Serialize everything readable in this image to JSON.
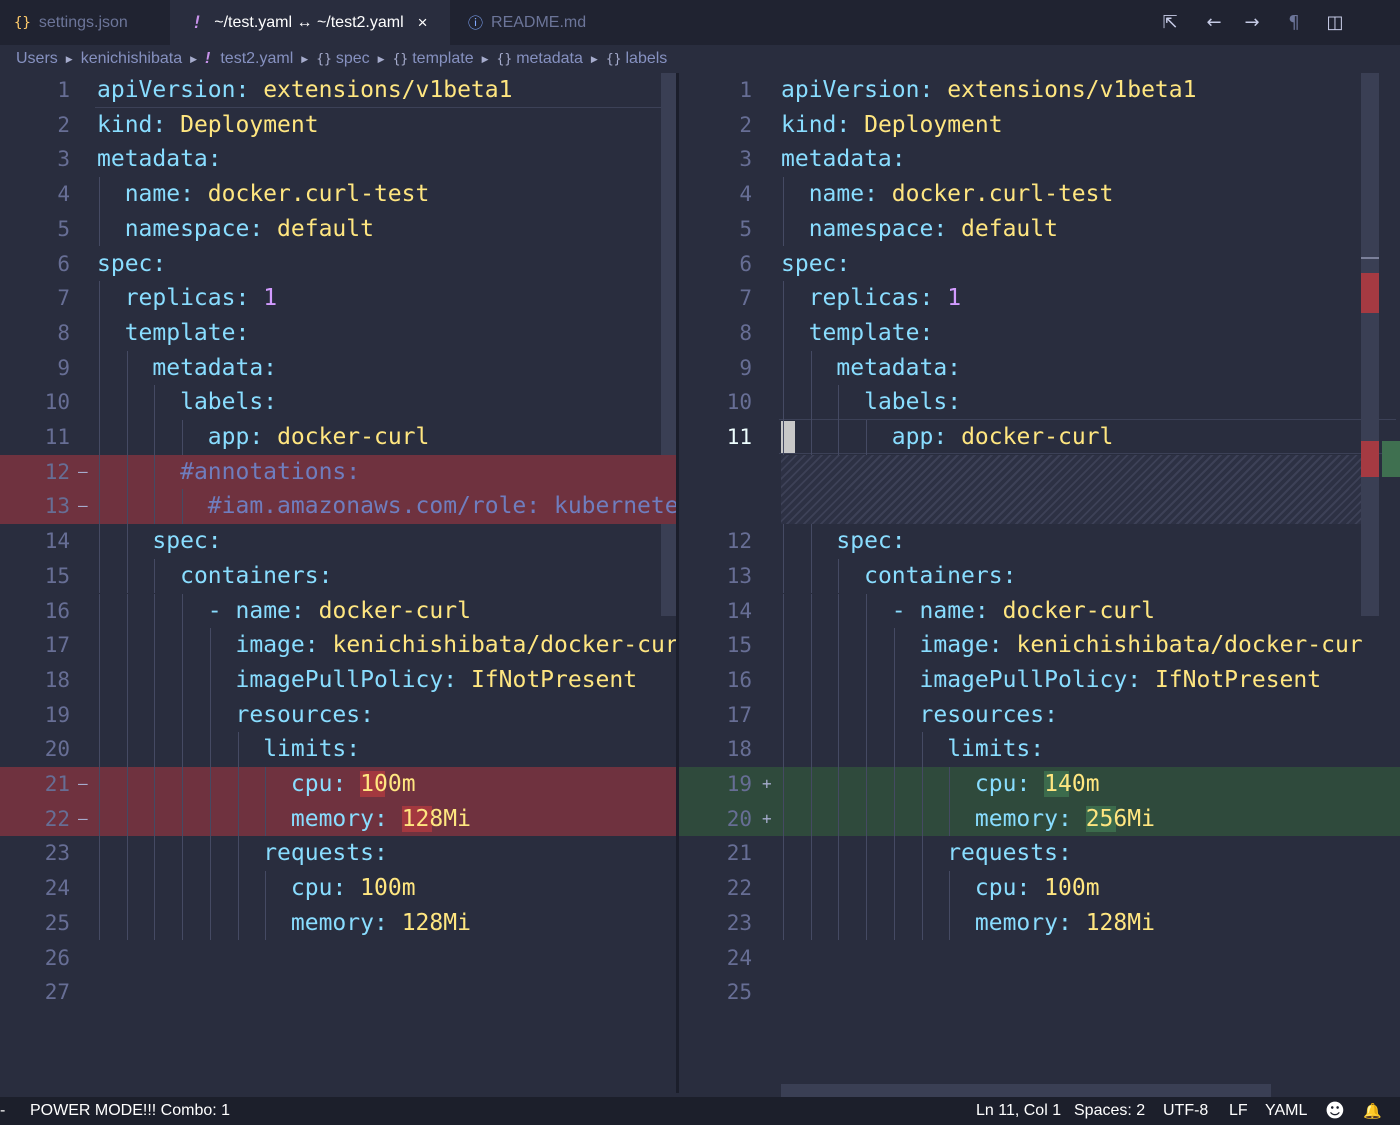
{
  "tabs": [
    {
      "icon": "{}",
      "label": "settings.json",
      "active": false
    },
    {
      "icon": "!",
      "label": "~/test.yaml ↔ ~/test2.yaml",
      "active": true,
      "close": "×"
    },
    {
      "icon": "ⓘ",
      "label": "README.md",
      "active": false
    }
  ],
  "toolbar": {
    "open_changes": "⇱",
    "prev_change": "←",
    "next_change": "→",
    "whitespace": "¶",
    "split": "◫"
  },
  "breadcrumb": {
    "items": [
      "Users",
      "kenichishibata",
      "test2.yaml",
      "spec",
      "template",
      "metadata",
      "labels"
    ],
    "file_icon": "!",
    "obj_icon": "{}"
  },
  "left_editor": {
    "lines": [
      {
        "n": "1",
        "marker": "",
        "indent": 0,
        "key": "apiVersion",
        "value": "extensions/v1beta1",
        "vtype": "v",
        "state": ""
      },
      {
        "n": "2",
        "marker": "",
        "indent": 0,
        "key": "kind",
        "value": "Deployment",
        "vtype": "v",
        "state": ""
      },
      {
        "n": "3",
        "marker": "",
        "indent": 0,
        "key": "metadata",
        "value": "",
        "vtype": "",
        "state": ""
      },
      {
        "n": "4",
        "marker": "",
        "indent": 1,
        "key": "name",
        "value": "docker.curl-test",
        "vtype": "v",
        "state": ""
      },
      {
        "n": "5",
        "marker": "",
        "indent": 1,
        "key": "namespace",
        "value": "default",
        "vtype": "v",
        "state": ""
      },
      {
        "n": "6",
        "marker": "",
        "indent": 0,
        "key": "spec",
        "value": "",
        "vtype": "",
        "state": ""
      },
      {
        "n": "7",
        "marker": "",
        "indent": 1,
        "key": "replicas",
        "value": "1",
        "vtype": "n",
        "state": ""
      },
      {
        "n": "8",
        "marker": "",
        "indent": 1,
        "key": "template",
        "value": "",
        "vtype": "",
        "state": ""
      },
      {
        "n": "9",
        "marker": "",
        "indent": 2,
        "key": "metadata",
        "value": "",
        "vtype": "",
        "state": ""
      },
      {
        "n": "10",
        "marker": "",
        "indent": 3,
        "key": "labels",
        "value": "",
        "vtype": "",
        "state": ""
      },
      {
        "n": "11",
        "marker": "",
        "indent": 4,
        "key": "app",
        "value": "docker-curl",
        "vtype": "v",
        "state": ""
      },
      {
        "n": "12",
        "marker": "–",
        "indent": 3,
        "comment": "#annotations:",
        "state": "del"
      },
      {
        "n": "13",
        "marker": "–",
        "indent": 4,
        "comment": "#iam.amazonaws.com/role: kubernete",
        "state": "del"
      },
      {
        "n": "14",
        "marker": "",
        "indent": 2,
        "key": "spec",
        "value": "",
        "vtype": "",
        "state": ""
      },
      {
        "n": "15",
        "marker": "",
        "indent": 3,
        "key": "containers",
        "value": "",
        "vtype": "",
        "state": ""
      },
      {
        "n": "16",
        "marker": "",
        "indent": 4,
        "dash": "- ",
        "key": "name",
        "value": "docker-curl",
        "vtype": "v",
        "state": ""
      },
      {
        "n": "17",
        "marker": "",
        "indent": 5,
        "key": "image",
        "value": "kenichishibata/docker-cur",
        "vtype": "v",
        "state": ""
      },
      {
        "n": "18",
        "marker": "",
        "indent": 5,
        "key": "imagePullPolicy",
        "value": "IfNotPresent",
        "vtype": "v",
        "state": ""
      },
      {
        "n": "19",
        "marker": "",
        "indent": 5,
        "key": "resources",
        "value": "",
        "vtype": "",
        "state": ""
      },
      {
        "n": "20",
        "marker": "",
        "indent": 6,
        "key": "limits",
        "value": "",
        "vtype": "",
        "state": ""
      },
      {
        "n": "21",
        "marker": "–",
        "indent": 7,
        "key": "cpu",
        "value": "100m",
        "vtype": "v",
        "state": "del",
        "hl": "10"
      },
      {
        "n": "22",
        "marker": "–",
        "indent": 7,
        "key": "memory",
        "value": "128Mi",
        "vtype": "v",
        "state": "del",
        "hl": "12"
      },
      {
        "n": "23",
        "marker": "",
        "indent": 6,
        "key": "requests",
        "value": "",
        "vtype": "",
        "state": ""
      },
      {
        "n": "24",
        "marker": "",
        "indent": 7,
        "key": "cpu",
        "value": "100m",
        "vtype": "v",
        "state": ""
      },
      {
        "n": "25",
        "marker": "",
        "indent": 7,
        "key": "memory",
        "value": "128Mi",
        "vtype": "v",
        "state": ""
      },
      {
        "n": "26",
        "marker": "",
        "indent": 0,
        "key": "",
        "value": "",
        "vtype": "",
        "state": ""
      },
      {
        "n": "27",
        "marker": "",
        "indent": 0,
        "key": "",
        "value": "",
        "vtype": "",
        "state": ""
      }
    ]
  },
  "right_editor": {
    "lines": [
      {
        "n": "1",
        "marker": "",
        "indent": 0,
        "key": "apiVersion",
        "value": "extensions/v1beta1",
        "vtype": "v",
        "state": ""
      },
      {
        "n": "2",
        "marker": "",
        "indent": 0,
        "key": "kind",
        "value": "Deployment",
        "vtype": "v",
        "state": ""
      },
      {
        "n": "3",
        "marker": "",
        "indent": 0,
        "key": "metadata",
        "value": "",
        "vtype": "",
        "state": ""
      },
      {
        "n": "4",
        "marker": "",
        "indent": 1,
        "key": "name",
        "value": "docker.curl-test",
        "vtype": "v",
        "state": ""
      },
      {
        "n": "5",
        "marker": "",
        "indent": 1,
        "key": "namespace",
        "value": "default",
        "vtype": "v",
        "state": ""
      },
      {
        "n": "6",
        "marker": "",
        "indent": 0,
        "key": "spec",
        "value": "",
        "vtype": "",
        "state": ""
      },
      {
        "n": "7",
        "marker": "",
        "indent": 1,
        "key": "replicas",
        "value": "1",
        "vtype": "n",
        "state": ""
      },
      {
        "n": "8",
        "marker": "",
        "indent": 1,
        "key": "template",
        "value": "",
        "vtype": "",
        "state": ""
      },
      {
        "n": "9",
        "marker": "",
        "indent": 2,
        "key": "metadata",
        "value": "",
        "vtype": "",
        "state": ""
      },
      {
        "n": "10",
        "marker": "",
        "indent": 3,
        "key": "labels",
        "value": "",
        "vtype": "",
        "state": ""
      },
      {
        "n": "11",
        "marker": "",
        "indent": 4,
        "key": "app",
        "value": "docker-curl",
        "vtype": "v",
        "state": "cur"
      },
      {
        "n": "",
        "marker": "",
        "indent": 0,
        "key": "",
        "value": "",
        "vtype": "",
        "state": "hatch"
      },
      {
        "n": "",
        "marker": "",
        "indent": 0,
        "key": "",
        "value": "",
        "vtype": "",
        "state": "hatch"
      },
      {
        "n": "12",
        "marker": "",
        "indent": 2,
        "key": "spec",
        "value": "",
        "vtype": "",
        "state": ""
      },
      {
        "n": "13",
        "marker": "",
        "indent": 3,
        "key": "containers",
        "value": "",
        "vtype": "",
        "state": ""
      },
      {
        "n": "14",
        "marker": "",
        "indent": 4,
        "dash": "- ",
        "key": "name",
        "value": "docker-curl",
        "vtype": "v",
        "state": ""
      },
      {
        "n": "15",
        "marker": "",
        "indent": 5,
        "key": "image",
        "value": "kenichishibata/docker-cur",
        "vtype": "v",
        "state": ""
      },
      {
        "n": "16",
        "marker": "",
        "indent": 5,
        "key": "imagePullPolicy",
        "value": "IfNotPresent",
        "vtype": "v",
        "state": ""
      },
      {
        "n": "17",
        "marker": "",
        "indent": 5,
        "key": "resources",
        "value": "",
        "vtype": "",
        "state": ""
      },
      {
        "n": "18",
        "marker": "",
        "indent": 6,
        "key": "limits",
        "value": "",
        "vtype": "",
        "state": ""
      },
      {
        "n": "19",
        "marker": "+",
        "indent": 7,
        "key": "cpu",
        "value": "140m",
        "vtype": "v",
        "state": "add",
        "hl": "10"
      },
      {
        "n": "20",
        "marker": "+",
        "indent": 7,
        "key": "memory",
        "value": "256Mi",
        "vtype": "v",
        "state": "add",
        "hl": "12"
      },
      {
        "n": "21",
        "marker": "",
        "indent": 6,
        "key": "requests",
        "value": "",
        "vtype": "",
        "state": ""
      },
      {
        "n": "22",
        "marker": "",
        "indent": 7,
        "key": "cpu",
        "value": "100m",
        "vtype": "v",
        "state": ""
      },
      {
        "n": "23",
        "marker": "",
        "indent": 7,
        "key": "memory",
        "value": "128Mi",
        "vtype": "v",
        "state": ""
      },
      {
        "n": "24",
        "marker": "",
        "indent": 0,
        "key": "",
        "value": "",
        "vtype": "",
        "state": ""
      },
      {
        "n": "25",
        "marker": "",
        "indent": 0,
        "key": "",
        "value": "",
        "vtype": "",
        "state": ""
      }
    ]
  },
  "status": {
    "left": "POWER MODE!!! Combo: 1",
    "position": "Ln 11, Col 1",
    "spaces": "Spaces: 2",
    "encoding": "UTF-8",
    "eol": "LF",
    "language": "YAML",
    "feedback_icon": "☻",
    "bell_icon": "🔔"
  },
  "colors": {
    "editor_bg": "#292d3e",
    "deleted": "#6f323f",
    "inserted": "#2f4a3c",
    "key": "#89ddff",
    "value": "#ffe680",
    "number": "#d29bff",
    "comment": "#6f7dbe"
  }
}
